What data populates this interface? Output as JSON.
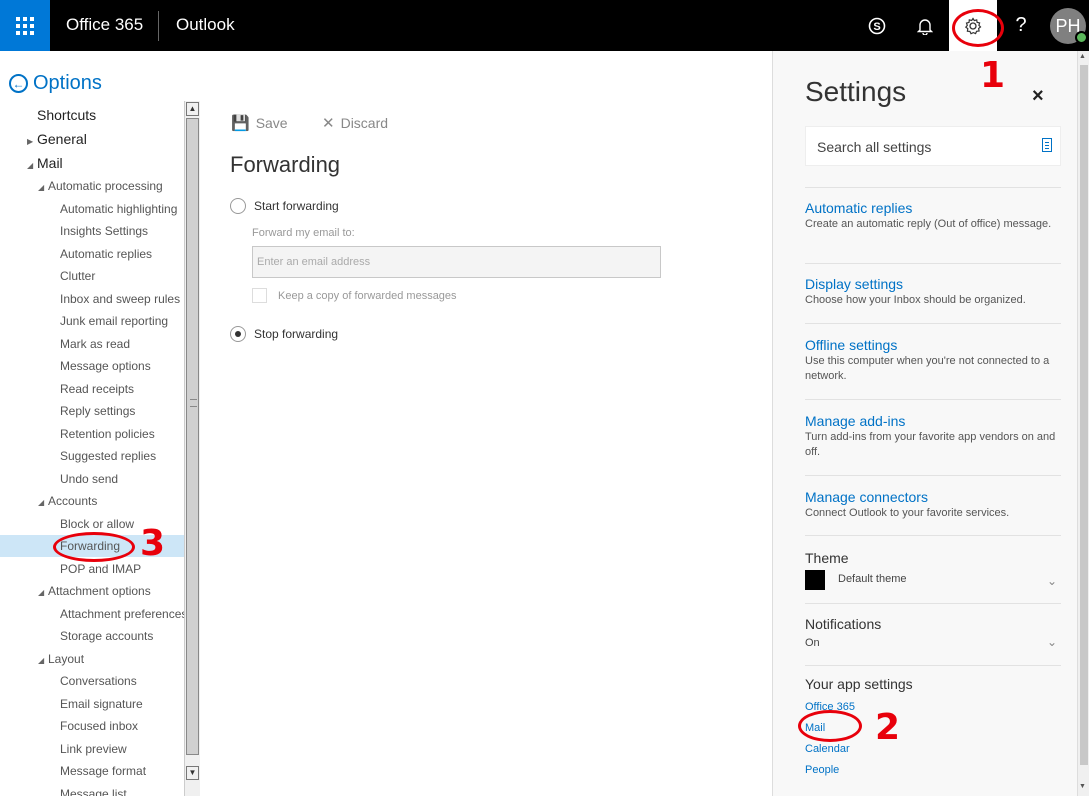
{
  "topbar": {
    "brand": "Office 365",
    "app": "Outlook",
    "user_initials": "PH",
    "help": "?"
  },
  "nav": {
    "back_label": "Options",
    "items": [
      {
        "label": "Shortcuts",
        "level": 1,
        "arrow": "",
        "top": 0
      },
      {
        "label": "General",
        "level": 1,
        "arrow": "right"
      },
      {
        "label": "Mail",
        "level": 1,
        "arrow": "down"
      },
      {
        "label": "Automatic processing",
        "level": 2,
        "arrow": "down"
      },
      {
        "label": "Automatic highlighting",
        "level": 3
      },
      {
        "label": "Insights Settings",
        "level": 3
      },
      {
        "label": "Automatic replies",
        "level": 3
      },
      {
        "label": "Clutter",
        "level": 3
      },
      {
        "label": "Inbox and sweep rules",
        "level": 3
      },
      {
        "label": "Junk email reporting",
        "level": 3
      },
      {
        "label": "Mark as read",
        "level": 3
      },
      {
        "label": "Message options",
        "level": 3
      },
      {
        "label": "Read receipts",
        "level": 3
      },
      {
        "label": "Reply settings",
        "level": 3
      },
      {
        "label": "Retention policies",
        "level": 3
      },
      {
        "label": "Suggested replies",
        "level": 3
      },
      {
        "label": "Undo send",
        "level": 3
      },
      {
        "label": "Accounts",
        "level": 2,
        "arrow": "down"
      },
      {
        "label": "Block or allow",
        "level": 3
      },
      {
        "label": "Forwarding",
        "level": 3,
        "selected": true
      },
      {
        "label": "POP and IMAP",
        "level": 3
      },
      {
        "label": "Attachment options",
        "level": 2,
        "arrow": "down"
      },
      {
        "label": "Attachment preferences",
        "level": 3
      },
      {
        "label": "Storage accounts",
        "level": 3
      },
      {
        "label": "Layout",
        "level": 2,
        "arrow": "down"
      },
      {
        "label": "Conversations",
        "level": 3
      },
      {
        "label": "Email signature",
        "level": 3
      },
      {
        "label": "Focused inbox",
        "level": 3
      },
      {
        "label": "Link preview",
        "level": 3
      },
      {
        "label": "Message format",
        "level": 3
      },
      {
        "label": "Message list",
        "level": 3
      }
    ]
  },
  "content": {
    "save_label": "Save",
    "discard_label": "Discard",
    "title": "Forwarding",
    "start_forwarding": "Start forwarding",
    "forward_to_label": "Forward my email to:",
    "email_placeholder": "Enter an email address",
    "keep_copy": "Keep a copy of forwarded messages",
    "stop_forwarding": "Stop forwarding",
    "selected_option": "stop"
  },
  "settings": {
    "title": "Settings",
    "close": "×",
    "search_placeholder": "Search all settings",
    "links": [
      {
        "title": "Automatic replies",
        "desc": "Create an automatic reply (Out of office) message."
      },
      {
        "title": "Display settings",
        "desc": "Choose how your Inbox should be organized."
      },
      {
        "title": "Offline settings",
        "desc": "Use this computer when you're not connected to a network."
      },
      {
        "title": "Manage add-ins",
        "desc": "Turn add-ins from your favorite app vendors on and off."
      },
      {
        "title": "Manage connectors",
        "desc": "Connect Outlook to your favorite services."
      }
    ],
    "theme_label": "Theme",
    "theme_value": "Default theme",
    "notifications_label": "Notifications",
    "notifications_value": "On",
    "app_settings_label": "Your app settings",
    "app_links": [
      "Office 365",
      "Mail",
      "Calendar",
      "People"
    ]
  },
  "annotations": [
    "1",
    "2",
    "3"
  ],
  "colors": {
    "accent": "#0072c6",
    "waffle": "#0078d7",
    "topbar": "#000000",
    "selection": "#cde6f7",
    "annotation": "#e8000b",
    "presence": "#5cb85c"
  },
  "icons": [
    "app-launcher-icon",
    "skype-icon",
    "bell-icon",
    "gear-icon",
    "help-icon",
    "back-arrow-icon",
    "save-icon",
    "discard-icon",
    "close-icon",
    "search-settings-icon",
    "chevron-down-icon"
  ]
}
